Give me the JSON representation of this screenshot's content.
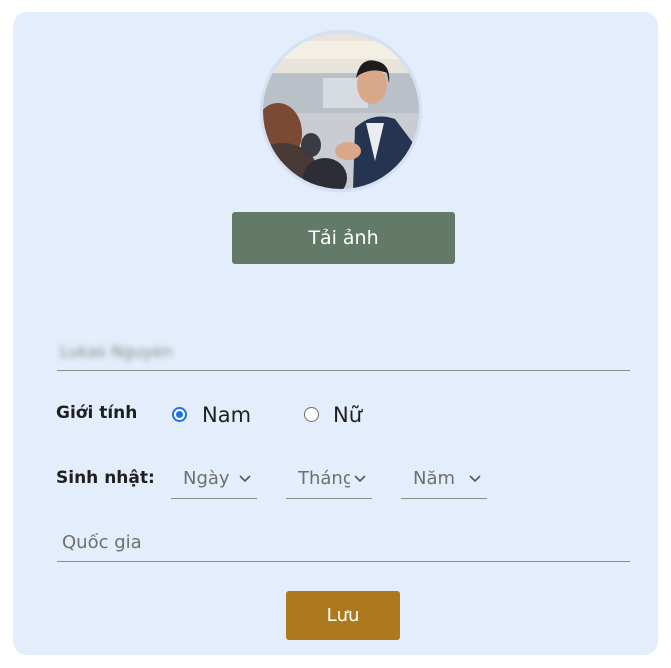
{
  "profile": {
    "avatar_alt": "",
    "upload_label": "Tải ảnh"
  },
  "form": {
    "name_value": "Lukas Nguyen",
    "gender_label": "Giới tính",
    "gender_options": [
      "Nam",
      "Nữ"
    ],
    "gender_selected": "Nam",
    "birthday_label": "Sinh nhật:",
    "day_select": "Ngày",
    "month_select": "Tháng",
    "year_select": "Năm",
    "country_placeholder": "Quốc gia",
    "save_label": "Lưu"
  },
  "colors": {
    "card_bg": "#e3edfb",
    "upload_button": "#627a67",
    "save_button": "#ac7a1c",
    "radio_accent": "#1a73e8"
  },
  "icons": {
    "select_chevron": "chevron-down-icon"
  }
}
